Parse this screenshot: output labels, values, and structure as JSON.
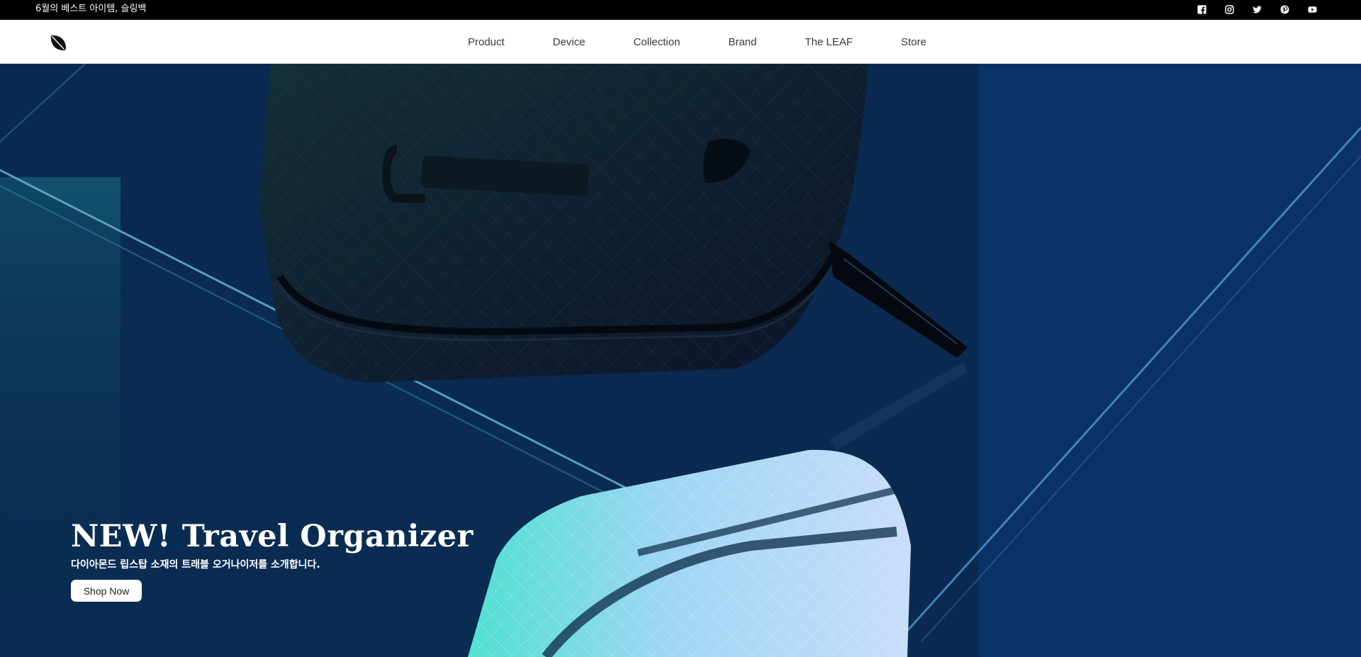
{
  "topbar": {
    "promo_text": "6월의 베스트 아이템, 슬링백",
    "social_icons": [
      "facebook-icon",
      "instagram-icon",
      "twitter-icon",
      "pinterest-icon",
      "youtube-icon"
    ]
  },
  "header": {
    "logo_icon": "leaf-logo-icon",
    "nav": [
      {
        "label": "Product"
      },
      {
        "label": "Device"
      },
      {
        "label": "Collection"
      },
      {
        "label": "Brand"
      },
      {
        "label": "The LEAF"
      },
      {
        "label": "Store"
      }
    ]
  },
  "hero": {
    "title": "NEW! Travel Organizer",
    "subtitle": "다이아몬드 립스탑 소재의 트래블 오거나이저를 소개합니다.",
    "cta_label": "Shop Now"
  },
  "colors": {
    "topbar_bg": "#000000",
    "header_bg": "#ffffff",
    "hero_bg": "#0a2c55",
    "cta_bg": "#ffffff"
  }
}
